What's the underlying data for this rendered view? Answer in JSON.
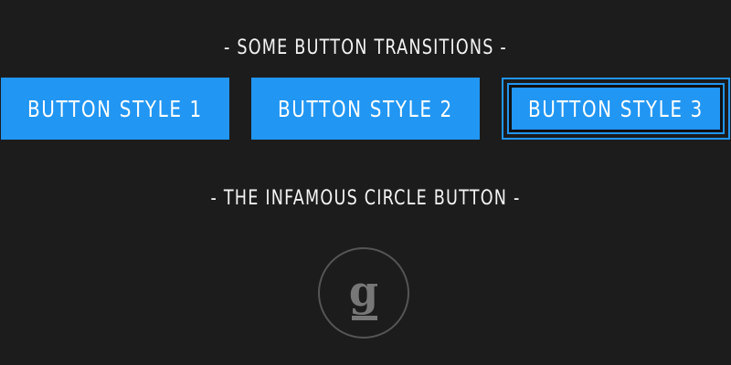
{
  "headings": {
    "transitions": "- SOME BUTTON TRANSITIONS -",
    "circle": "- THE INFAMOUS CIRCLE BUTTON -"
  },
  "buttons": [
    {
      "label": "BUTTON STYLE 1"
    },
    {
      "label": "BUTTON STYLE 2"
    },
    {
      "label": "BUTTON STYLE 3"
    }
  ],
  "circle_button": {
    "logo_letter": "g",
    "icon": "g-logo-icon"
  },
  "colors": {
    "background": "#1c1c1c",
    "accent": "#2196f3",
    "text": "#ffffff",
    "circle_border": "#555555",
    "logo": "#777777"
  }
}
